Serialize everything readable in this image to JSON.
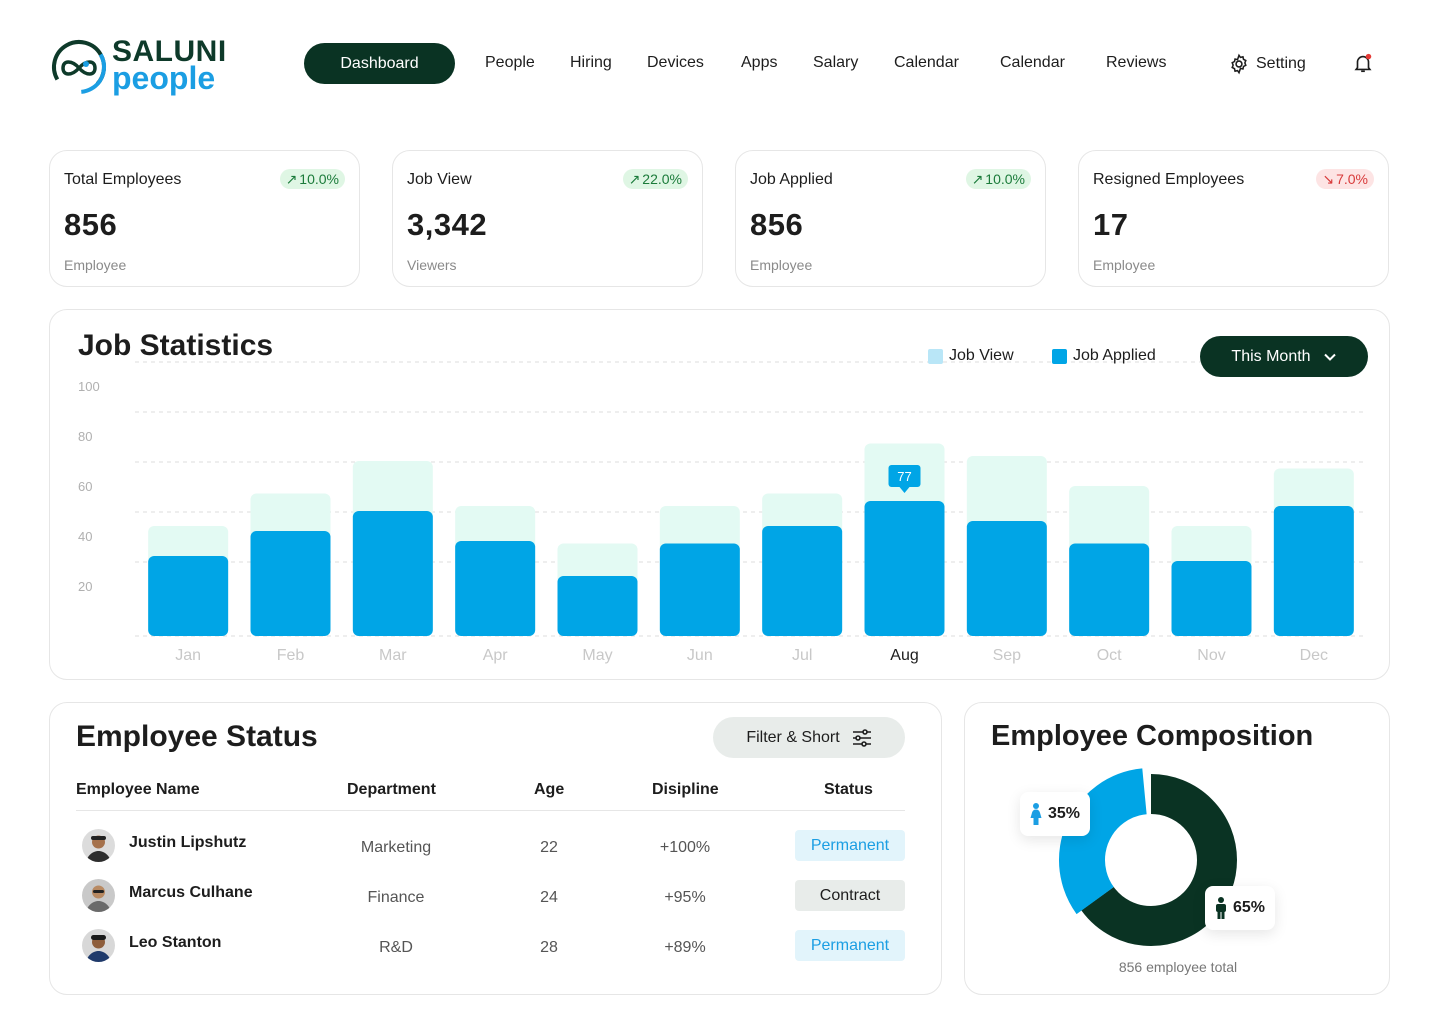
{
  "brand": {
    "line1": "SALUNI",
    "line2": "people"
  },
  "nav": {
    "active": "Dashboard",
    "items": [
      "People",
      "Hiring",
      "Devices",
      "Apps",
      "Salary",
      "Calendar",
      "Calendar",
      "Reviews"
    ],
    "setting_label": "Setting"
  },
  "colors": {
    "primary_dark": "#0a3323",
    "accent_blue": "#00a5e6",
    "light_mint": "#e3faf3",
    "up_badge": "#dff6e4",
    "down_badge": "#fde4e4"
  },
  "cards": [
    {
      "title": "Total Employees",
      "change": "10.0%",
      "trend": "up",
      "value": "856",
      "sub": "Employee"
    },
    {
      "title": "Job View",
      "change": "22.0%",
      "trend": "up",
      "value": "3,342",
      "sub": "Viewers"
    },
    {
      "title": "Job Applied",
      "change": "10.0%",
      "trend": "up",
      "value": "856",
      "sub": "Employee"
    },
    {
      "title": "Resigned Employees",
      "change": "7.0%",
      "trend": "down",
      "value": "17",
      "sub": "Employee"
    }
  ],
  "job_statistics": {
    "title": "Job Statistics",
    "legend": [
      "Job View",
      "Job Applied"
    ],
    "period_button": "This Month"
  },
  "chart_data": {
    "type": "bar",
    "categories": [
      "Jan",
      "Feb",
      "Mar",
      "Apr",
      "May",
      "Jun",
      "Jul",
      "Aug",
      "Sep",
      "Oct",
      "Nov",
      "Dec"
    ],
    "series": [
      {
        "name": "Job View",
        "values": [
          44,
          57,
          70,
          52,
          37,
          52,
          57,
          77,
          72,
          60,
          44,
          67
        ]
      },
      {
        "name": "Job Applied",
        "values": [
          32,
          42,
          50,
          38,
          24,
          37,
          44,
          54,
          46,
          37,
          30,
          52
        ]
      }
    ],
    "highlight": {
      "category": "Aug",
      "label": "77"
    },
    "yticks": [
      "100",
      "80",
      "60",
      "40",
      "20"
    ],
    "ylim": [
      0,
      100
    ],
    "grid": true,
    "legend": "top-right",
    "stacked": false
  },
  "employee_status": {
    "title": "Employee Status",
    "filter_label": "Filter & Short",
    "columns": [
      "Employee Name",
      "Department",
      "Age",
      "Disipline",
      "Status"
    ],
    "rows": [
      {
        "name": "Justin Lipshutz",
        "department": "Marketing",
        "age": "22",
        "discipline": "+100%",
        "status": "Permanent"
      },
      {
        "name": "Marcus Culhane",
        "department": "Finance",
        "age": "24",
        "discipline": "+95%",
        "status": "Contract"
      },
      {
        "name": "Leo Stanton",
        "department": "R&D",
        "age": "28",
        "discipline": "+89%",
        "status": "Permanent"
      }
    ]
  },
  "composition": {
    "title": "Employee Composition",
    "female_pct": "35%",
    "male_pct": "65%",
    "female_value": 35,
    "male_value": 65,
    "total_label": "856 employee total"
  }
}
